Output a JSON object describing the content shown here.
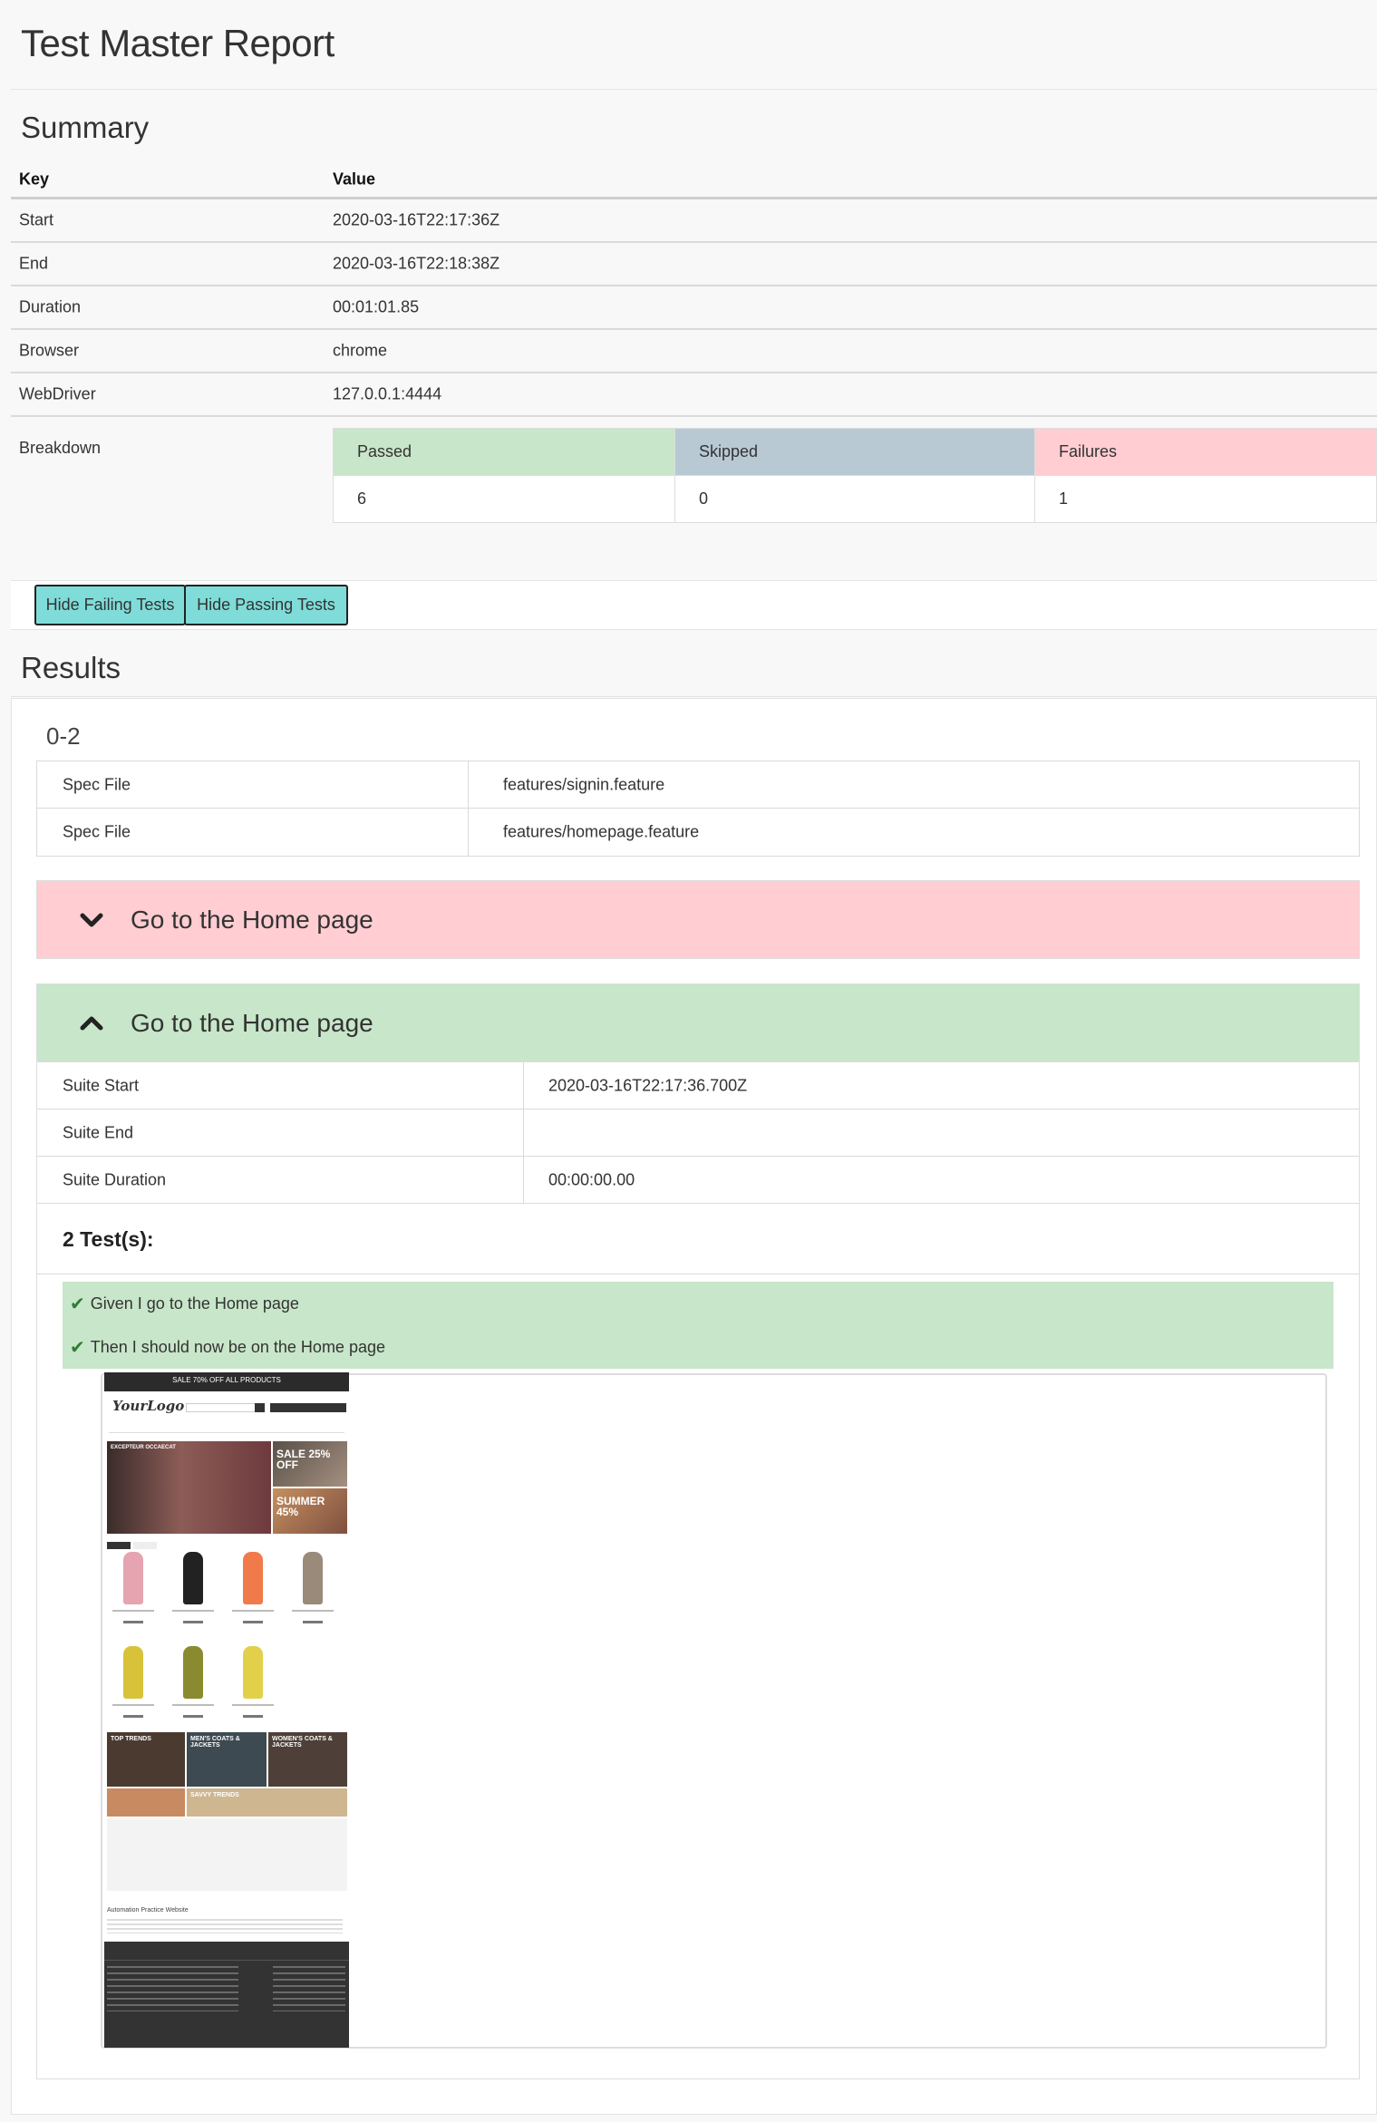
{
  "page": {
    "title": "Test Master Report"
  },
  "summary": {
    "heading": "Summary",
    "columns": {
      "key": "Key",
      "value": "Value"
    },
    "rows": [
      {
        "key": "Start",
        "value": "2020-03-16T22:17:36Z"
      },
      {
        "key": "End",
        "value": "2020-03-16T22:18:38Z"
      },
      {
        "key": "Duration",
        "value": "00:01:01.85"
      },
      {
        "key": "Browser",
        "value": "chrome"
      },
      {
        "key": "WebDriver",
        "value": "127.0.0.1:4444"
      }
    ],
    "breakdown": {
      "label": "Breakdown",
      "passed_label": "Passed",
      "skipped_label": "Skipped",
      "failures_label": "Failures",
      "passed": "6",
      "skipped": "0",
      "failures": "1"
    }
  },
  "actions": {
    "hide_failing": "Hide Failing Tests",
    "hide_passing": "Hide Passing Tests"
  },
  "results": {
    "heading": "Results",
    "group": {
      "title": "0-2",
      "spec_files": [
        {
          "key": "Spec File",
          "value": "features/signin.feature"
        },
        {
          "key": "Spec File",
          "value": "features/homepage.feature"
        }
      ],
      "suites": [
        {
          "title": "Go to the Home page",
          "status": "failed",
          "expanded": false
        },
        {
          "title": "Go to the Home page",
          "status": "passed",
          "expanded": true,
          "info": [
            {
              "key": "Suite Start",
              "value": "2020-03-16T22:17:36.700Z"
            },
            {
              "key": "Suite End",
              "value": ""
            },
            {
              "key": "Suite Duration",
              "value": "00:00:00.00"
            }
          ],
          "tests_count": "2 Test(s):",
          "steps": [
            {
              "check": "✔",
              "text": "Given I go to the Home page"
            },
            {
              "check": "✔",
              "text": "Then I should now be on the Home page"
            }
          ]
        }
      ]
    }
  },
  "screenshot": {
    "banner": "SALE 70% OFF ALL PRODUCTS",
    "logo": "YourLogo",
    "hero_text": "EXCEPTEUR OCCAECAT",
    "promo1": "SALE 25% OFF",
    "promo2": "SUMMER 45%",
    "tile1": "TOP TRENDS",
    "tile2": "MEN'S COATS & JACKETS",
    "tile3": "WOMEN'S COATS & JACKETS",
    "tile4": "SAVVY TRENDS",
    "about": "Automation Practice Website"
  },
  "colors": {
    "passed": "#c8e6c9",
    "skipped": "#b8c9d4",
    "failed": "#ffcdd2",
    "button": "#7fdcd8"
  }
}
